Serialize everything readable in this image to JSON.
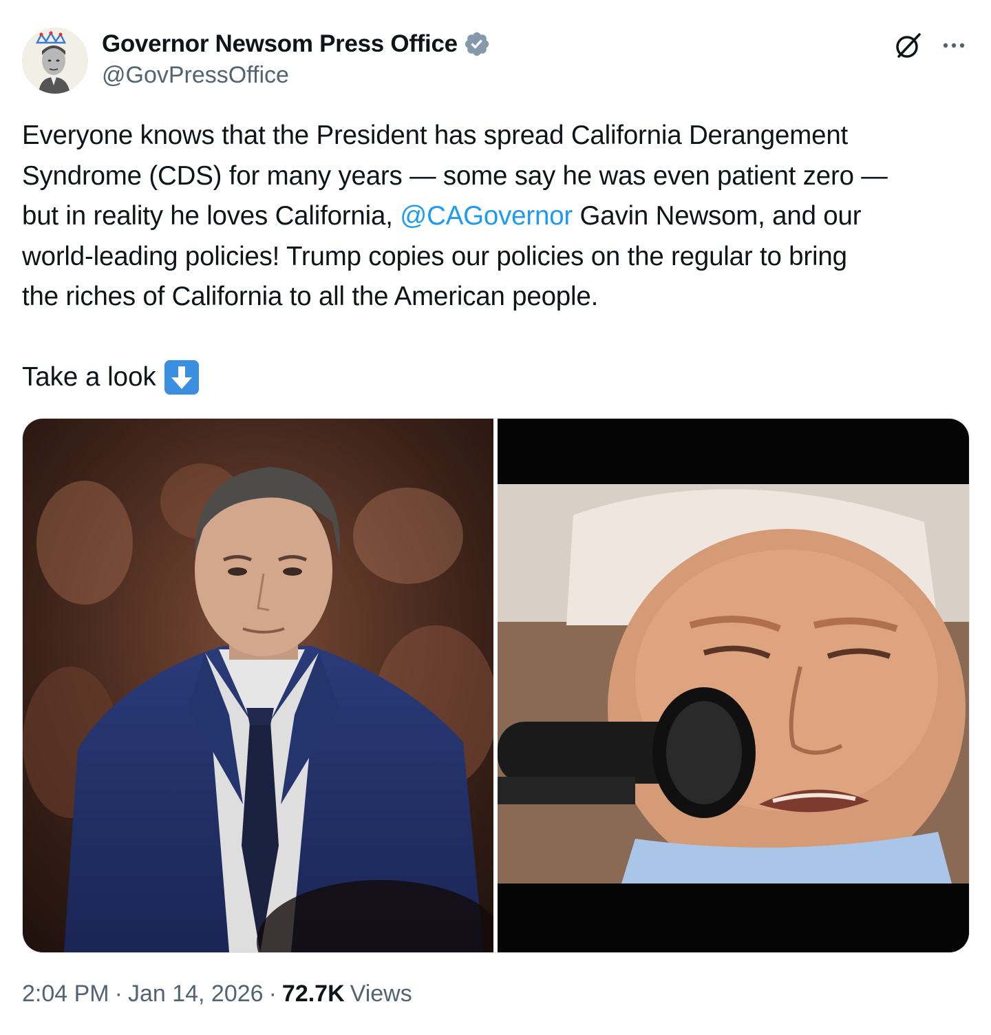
{
  "author": {
    "display_name": "Governor Newsom Press Office",
    "handle": "@GovPressOffice",
    "verified_badge_icon": "verified-badge-icon",
    "badge_color": "#829aab"
  },
  "tweet": {
    "text_lines": [
      "Everyone knows that the President has spread California Derangement",
      "Syndrome (CDS) for many years — some say he was even patient zero —",
      "but in reality he loves California, ",
      "world-leading policies! Trump copies our policies on the regular to bring",
      "the riches of California to all the American people."
    ],
    "mention": "@CAGovernor",
    "line3_after_mention": " Gavin Newsom, and our",
    "take_look": "Take a look",
    "take_look_emoji": "down-arrow-icon",
    "mention_color": "#1d9bf0"
  },
  "media": {
    "left_photo": "portrait-photo",
    "right_photo": "closeup-photo"
  },
  "footer": {
    "time": "2:04 PM",
    "separator": "·",
    "date": "Jan 14, 2026",
    "views_count": "72.7K",
    "views_label": "Views"
  },
  "icons": {
    "grok": "grok-icon",
    "more": "more-icon"
  }
}
